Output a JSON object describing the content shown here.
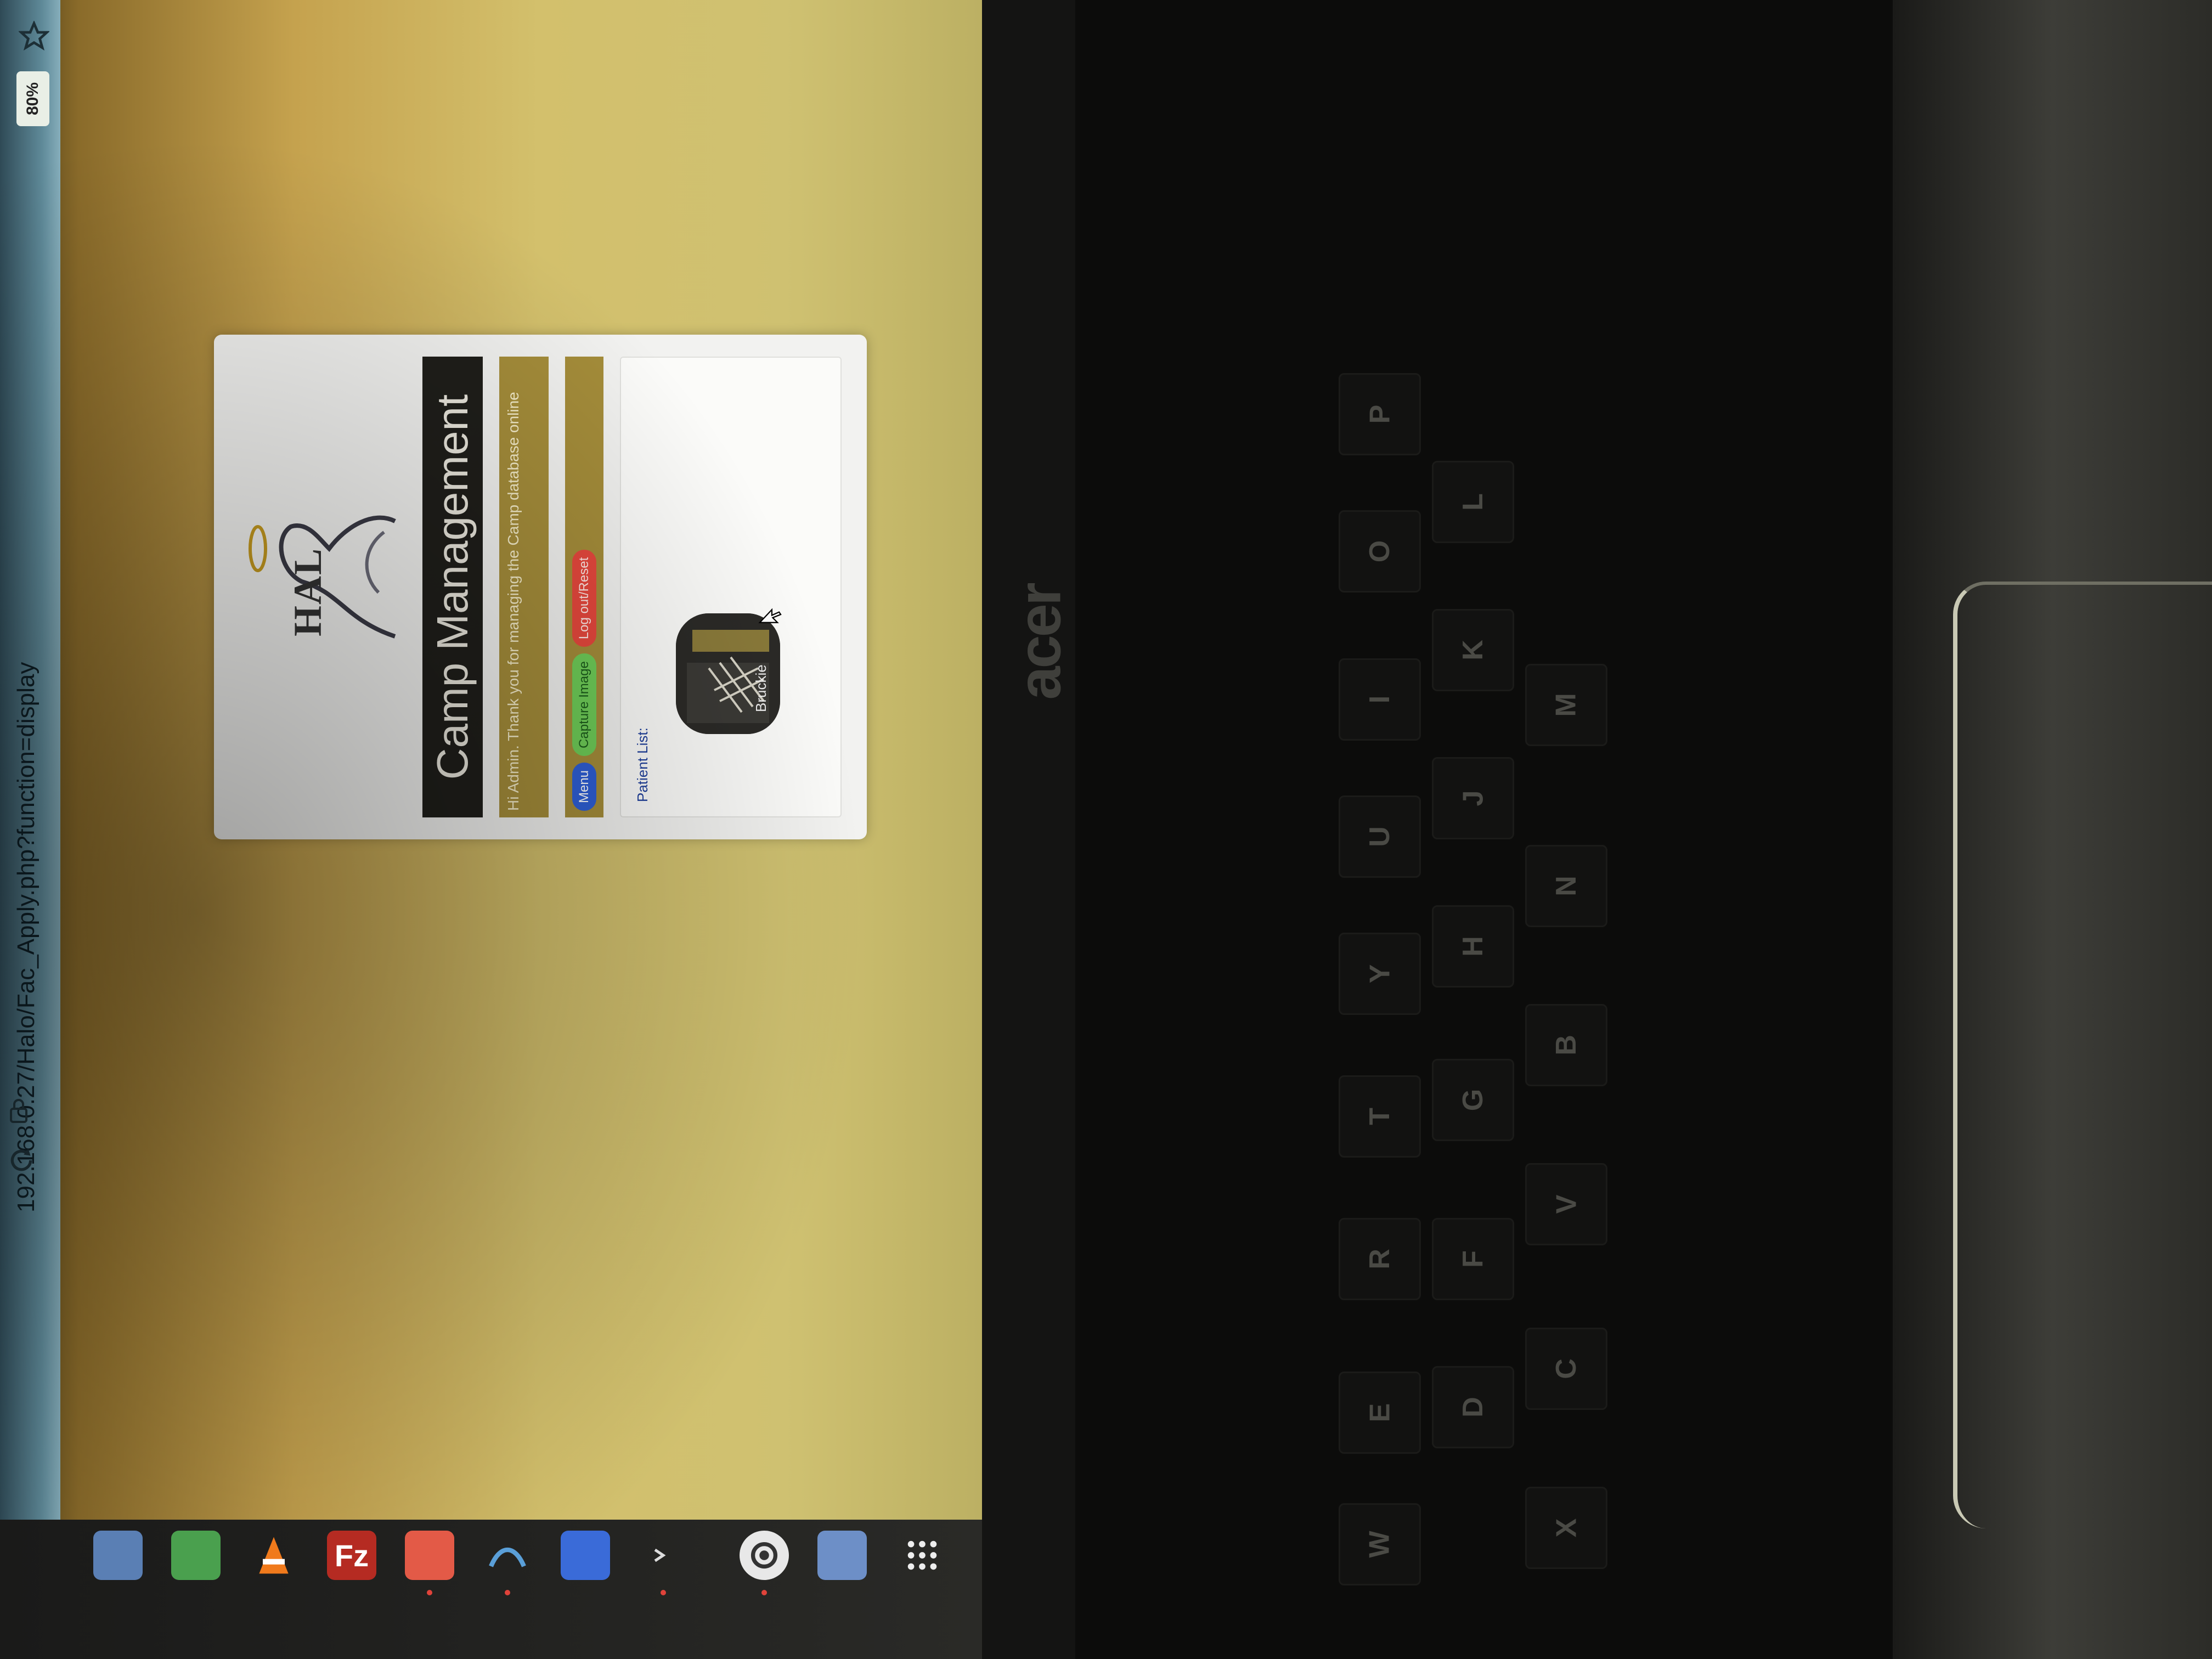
{
  "browser": {
    "url": "192.168.0.27/Halo/Fac_Apply.php?function=display",
    "zoom": "80%"
  },
  "card": {
    "logo_text": "HAL",
    "title": "Camp Management",
    "welcome": "Hi Admin. Thank you for managing the Camp database online",
    "nav": {
      "menu_label": "Menu",
      "capture_label": "Capture Image",
      "logout_label": "Log out/Reset"
    },
    "patients": {
      "label": "Patient List:",
      "items": [
        {
          "name": "Bruckie"
        }
      ]
    }
  },
  "laptop": {
    "brand": "acer",
    "keys": [
      "W",
      "E",
      "R",
      "T",
      "Y",
      "U",
      "I",
      "O",
      "P",
      "D",
      "F",
      "G",
      "H",
      "J",
      "K",
      "L",
      "X",
      "C",
      "V",
      "B",
      "N",
      "M"
    ]
  },
  "colors": {
    "title_bar": "#1f1e1a",
    "accent_bar": "#a58d3a",
    "menu_button": "#2e5fd6",
    "capture_button": "#6fcd58",
    "logout_button": "#e6483d"
  },
  "taskbar": {
    "icons": [
      "files-icon",
      "spreadsheet-icon",
      "vlc-icon",
      "filezilla-icon",
      "anydesk-icon",
      "inkscape-icon",
      "text-editor-icon",
      "terminal-icon",
      "settings-icon",
      "update-icon",
      "app-grid-icon"
    ]
  }
}
